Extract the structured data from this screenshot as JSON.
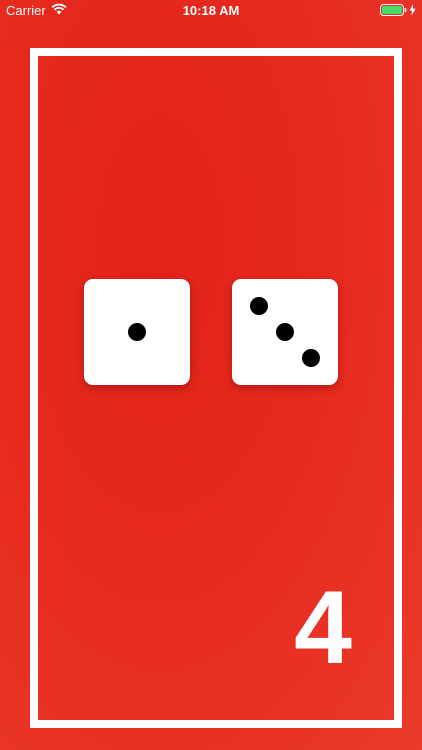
{
  "status_bar": {
    "carrier": "Carrier",
    "time": "10:18 AM",
    "battery_color": "#4cd964"
  },
  "dice": [
    {
      "value": 1,
      "icon": "die-one-icon"
    },
    {
      "value": 3,
      "icon": "die-three-icon"
    }
  ],
  "total": "4",
  "colors": {
    "background": "#e6291e",
    "frame": "#ffffff",
    "die_face": "#ffffff",
    "pip": "#000000"
  }
}
